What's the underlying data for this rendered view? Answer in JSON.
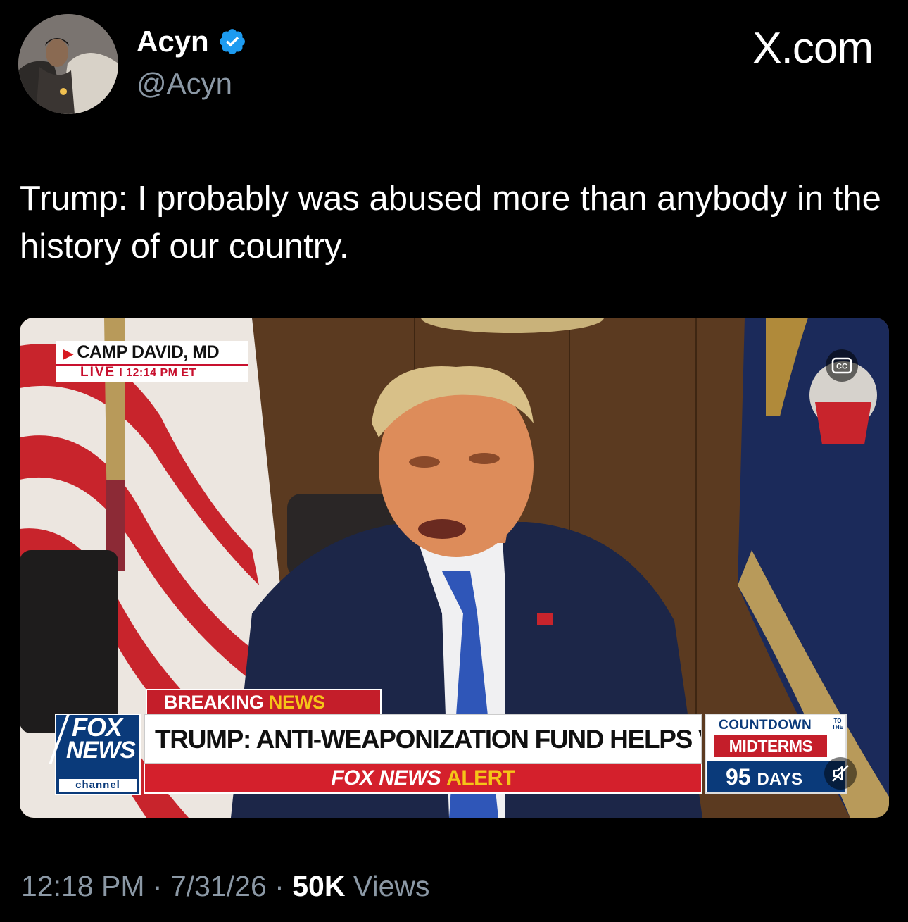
{
  "author": {
    "name": "Acyn",
    "handle": "@Acyn",
    "verified": true,
    "verified_color": "#1d9bf0"
  },
  "site_logo": "X.com",
  "tweet": {
    "text": "Trump: I probably was abused more than anybody in the history of our country."
  },
  "media": {
    "location_line": "CAMP DAVID, MD",
    "live_label": "LIVE",
    "live_separator": "I",
    "live_time": "12:14 PM ET",
    "breaking_label": "BREAKING",
    "breaking_news_word": "NEWS",
    "headline": "TRUMP: ANTI-WEAPONIZATION FUND HELPS VICTIMS",
    "alert_prefix": "FOX NEWS",
    "alert_word": "ALERT",
    "network_top": "FOX",
    "network_bottom": "NEWS",
    "network_channel": "channel",
    "countdown_title": "COUNTDOWN",
    "countdown_to_the": "TO THE",
    "countdown_event": "MIDTERMS",
    "countdown_number": "95",
    "countdown_unit": "DAYS",
    "icons": [
      "cc-icon",
      "mute-icon"
    ]
  },
  "meta": {
    "time": "12:18 PM",
    "separator": "·",
    "date": "7/31/26",
    "views_count": "50K",
    "views_label": "Views"
  },
  "colors": {
    "background": "#000000",
    "text_primary": "#ffffff",
    "text_secondary": "#8b98a5",
    "fox_red": "#c41e2a",
    "fox_blue": "#0a3a7a",
    "fox_yellow": "#f5c518"
  }
}
